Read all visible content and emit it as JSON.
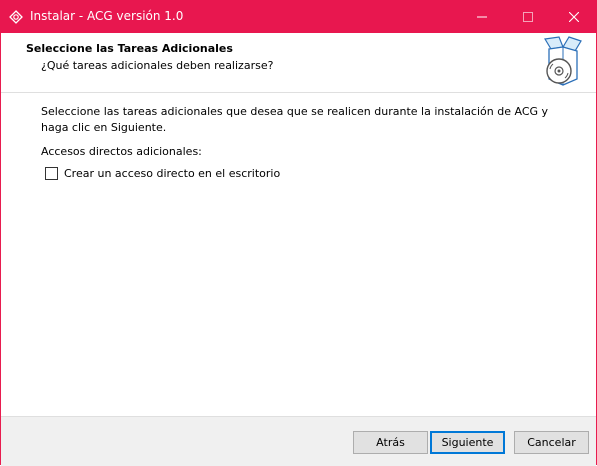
{
  "window": {
    "title": "Instalar - ACG versión 1.0",
    "accent_color": "#e8174f",
    "controls": {
      "minimize_icon": "minimize-icon",
      "maximize_icon": "maximize-icon",
      "close_icon": "close-icon"
    }
  },
  "header": {
    "title": "Seleccione las Tareas Adicionales",
    "subtitle": "¿Qué tareas adicionales deben realizarse?",
    "icon": "installer-box-disc-icon"
  },
  "content": {
    "description": "Seleccione las tareas adicionales que desea que se realicen durante la instalación de ACG y haga clic en Siguiente.",
    "group_label": "Accesos directos adicionales:",
    "tasks": [
      {
        "label": "Crear un acceso directo en el escritorio",
        "checked": false
      }
    ]
  },
  "footer": {
    "back_label": "Atrás",
    "next_label": "Siguiente",
    "cancel_label": "Cancelar"
  }
}
